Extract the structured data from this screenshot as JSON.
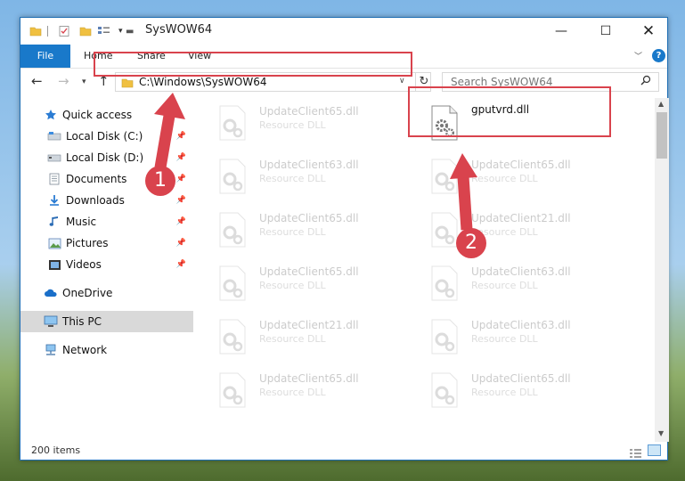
{
  "window": {
    "title": "SysWOW64",
    "controls": {
      "minimize": "—",
      "maximize": "☐",
      "close": "✕"
    }
  },
  "ribbon": {
    "tabs": [
      "File",
      "Home",
      "Share",
      "View"
    ],
    "help": "?"
  },
  "navigation": {
    "address": "C:\\Windows\\SysWOW64",
    "search_placeholder": "Search SysWOW64"
  },
  "sidebar": {
    "items": [
      {
        "label": "Quick access",
        "icon": "star-icon",
        "pinned": false
      },
      {
        "label": "Local Disk (C:)",
        "icon": "drive-icon",
        "pinned": true
      },
      {
        "label": "Local Disk (D:)",
        "icon": "drive-icon",
        "pinned": true
      },
      {
        "label": "Documents",
        "icon": "documents-icon",
        "pinned": true
      },
      {
        "label": "Downloads",
        "icon": "download-icon",
        "pinned": true
      },
      {
        "label": "Music",
        "icon": "music-icon",
        "pinned": true
      },
      {
        "label": "Pictures",
        "icon": "pictures-icon",
        "pinned": true
      },
      {
        "label": "Videos",
        "icon": "videos-icon",
        "pinned": true
      },
      {
        "label": "OneDrive",
        "icon": "cloud-icon",
        "pinned": false
      },
      {
        "label": "This PC",
        "icon": "computer-icon",
        "pinned": false,
        "selected": true
      },
      {
        "label": "Network",
        "icon": "network-icon",
        "pinned": false
      }
    ]
  },
  "files": {
    "left_column": [
      {
        "name": "UpdateClient65.dll",
        "type": "Resource DLL"
      },
      {
        "name": "UpdateClient63.dll",
        "type": "Resource DLL"
      },
      {
        "name": "UpdateClient65.dll",
        "type": "Resource DLL"
      },
      {
        "name": "UpdateClient65.dll",
        "type": "Resource DLL"
      },
      {
        "name": "UpdateClient21.dll",
        "type": "Resource DLL"
      },
      {
        "name": "UpdateClient65.dll",
        "type": "Resource DLL"
      }
    ],
    "right_column": [
      {
        "name": "gputvrd.dll",
        "type": "",
        "highlighted": true
      },
      {
        "name": "UpdateClient65.dll",
        "type": "Resource DLL"
      },
      {
        "name": "UpdateClient21.dll",
        "type": "Resource DLL"
      },
      {
        "name": "UpdateClient63.dll",
        "type": "Resource DLL"
      },
      {
        "name": "UpdateClient63.dll",
        "type": "Resource DLL"
      },
      {
        "name": "UpdateClient65.dll",
        "type": "Resource DLL"
      }
    ]
  },
  "status": {
    "item_count": "200 items"
  },
  "callouts": [
    "1",
    "2"
  ],
  "colors": {
    "accent": "#1979ca",
    "annotation": "#d9434d",
    "selected": "#d9d9d9"
  }
}
